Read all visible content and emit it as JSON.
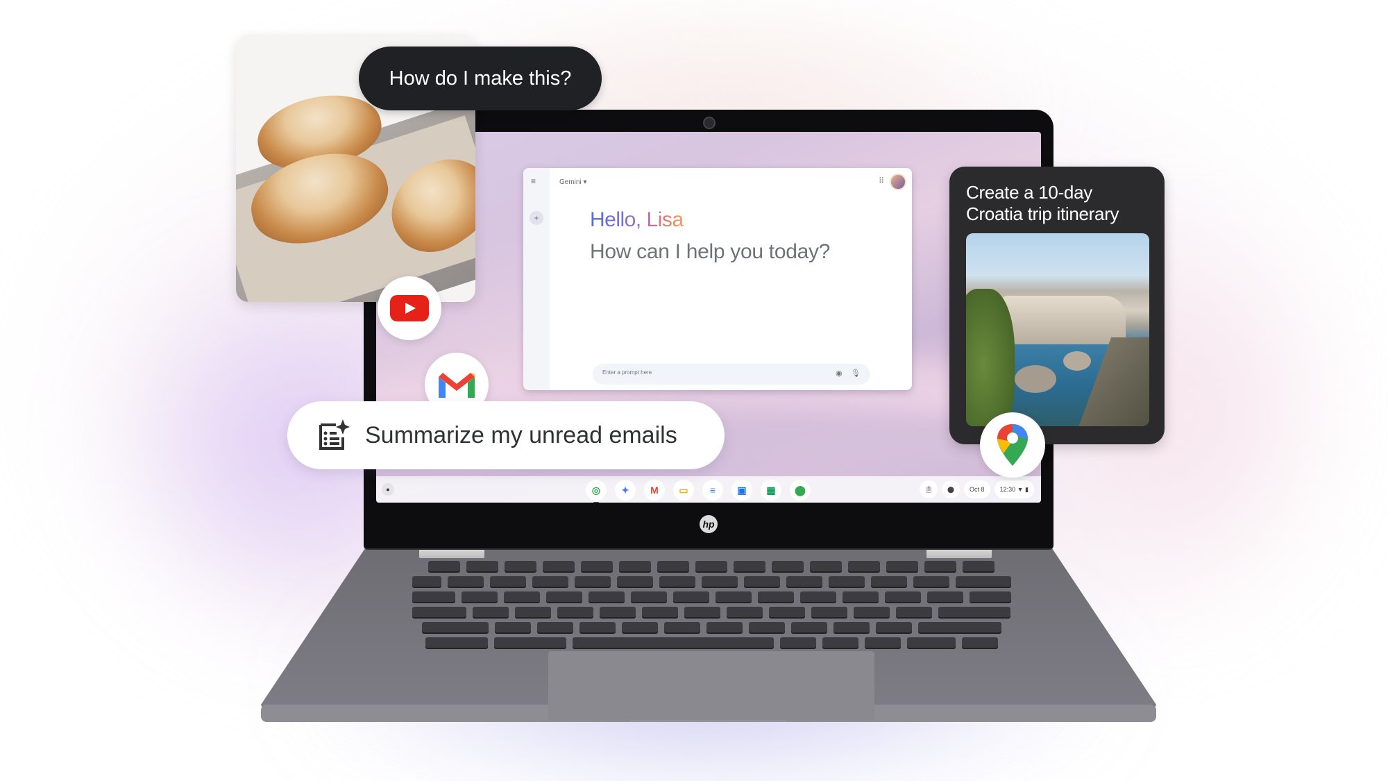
{
  "scene": {
    "description": "ChromeOS laptop with Gemini prompts",
    "brand_logo": "hp"
  },
  "gemini_window": {
    "title": "Gemini",
    "title_caret": "▾",
    "greeting_prefix": "Hello, ",
    "greeting_name": "Lisa",
    "subtitle": "How can I help you today?",
    "prompt_placeholder": "Enter a prompt here",
    "menu_icon": "hamburger-icon",
    "new_chat_icon": "plus-icon",
    "apps_icon": "apps-grid-icon",
    "image_icon": "image-icon",
    "mic_icon": "mic-icon"
  },
  "shelf": {
    "launcher_icon": "launcher-icon",
    "apps": [
      {
        "name": "Chrome",
        "icon": "chrome-icon",
        "glyph": "◎",
        "color": "#34a853",
        "active": true
      },
      {
        "name": "Gemini",
        "icon": "gemini-icon",
        "glyph": "✦",
        "color": "#4e7df0",
        "active": false
      },
      {
        "name": "Gmail",
        "icon": "gmail-icon",
        "glyph": "M",
        "color": "#ea4335",
        "active": false
      },
      {
        "name": "Slides",
        "icon": "slides-icon",
        "glyph": "▭",
        "color": "#f4b400",
        "active": false
      },
      {
        "name": "Docs",
        "icon": "docs-icon",
        "glyph": "≡",
        "color": "#4285f4",
        "active": false
      },
      {
        "name": "Photos/Files",
        "icon": "files-icon",
        "glyph": "▣",
        "color": "#1a73e8",
        "active": false
      },
      {
        "name": "Sheets",
        "icon": "sheets-icon",
        "glyph": "▦",
        "color": "#0f9d58",
        "active": false
      },
      {
        "name": "Maps",
        "icon": "maps-icon",
        "glyph": "⬤",
        "color": "#34a853",
        "active": false
      }
    ],
    "tray": {
      "clipboard_icon": "clipboard-icon",
      "record_icon": "record-icon",
      "date": "Oct 8",
      "time": "12:30",
      "wifi_icon": "wifi-icon",
      "battery_icon": "battery-icon"
    }
  },
  "cards": {
    "recipe_question": "How do I make this?",
    "recipe_app_icon": "youtube-icon",
    "email_app_icon": "gmail-icon",
    "email_prompt": "Summarize my unread emails",
    "email_prompt_icon": "summarize-sparkle-icon",
    "trip_prompt": "Create a 10-day Croatia trip itinerary",
    "trip_app_icon": "google-maps-icon"
  },
  "colors": {
    "youtube_red": "#e62117",
    "dark_bubble": "#202124",
    "gemini_blue": "#4c6fd8",
    "gemini_pink": "#e07a6a"
  }
}
